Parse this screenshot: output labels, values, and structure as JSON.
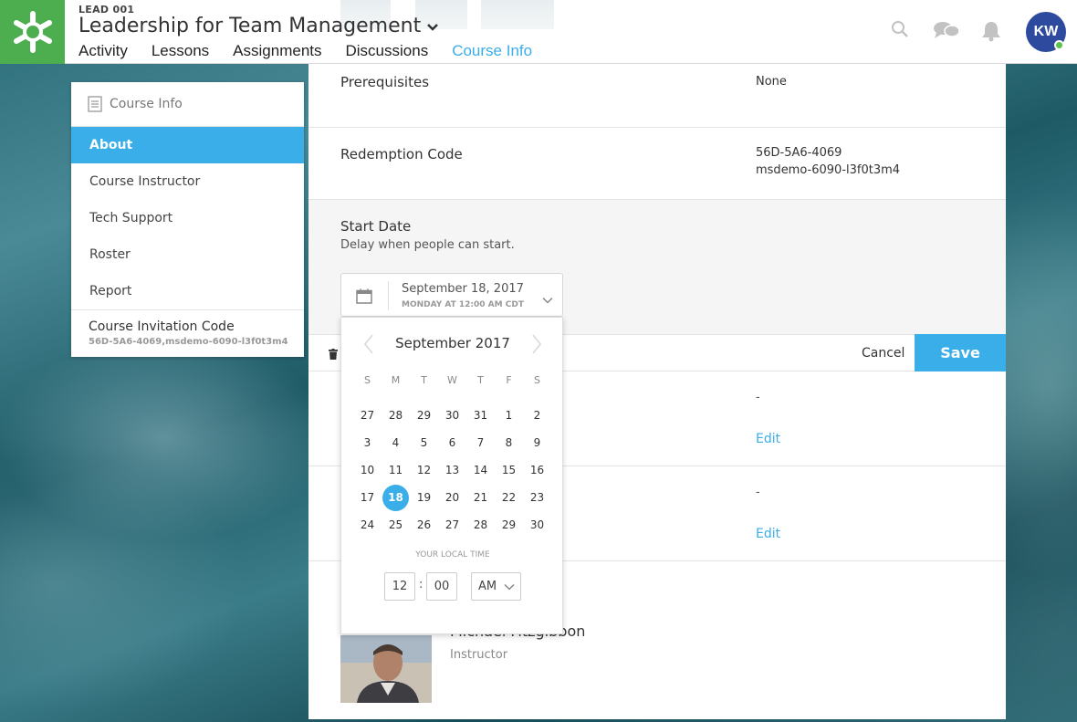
{
  "header": {
    "course_code": "LEAD 001",
    "course_title": "Leadership for Team Management",
    "tabs": [
      {
        "label": "Activity"
      },
      {
        "label": "Lessons"
      },
      {
        "label": "Assignments"
      },
      {
        "label": "Discussions"
      },
      {
        "label": "Course Info",
        "active": true
      }
    ],
    "avatar_initials": "KW",
    "icons": [
      "search-icon",
      "chat-icon",
      "bell-icon"
    ],
    "brand_color": "#4cae4f",
    "accent_color": "#3aaee8"
  },
  "sidebar": {
    "title": "Course Info",
    "items": [
      {
        "label": "About",
        "active": true
      },
      {
        "label": "Course Instructor"
      },
      {
        "label": "Tech Support"
      },
      {
        "label": "Roster"
      },
      {
        "label": "Report"
      }
    ],
    "invitation_label": "Course Invitation Code",
    "invitation_code": "56D-5A6-4069,msdemo-6090-l3f0t3m4"
  },
  "main": {
    "prerequisites_label": "Prerequisites",
    "prerequisites_value": "None",
    "redemption_label": "Redemption Code",
    "redemption_line1": "56D-5A6-4069",
    "redemption_line2": "msdemo-6090-l3f0t3m4",
    "start_date_label": "Start Date",
    "start_date_sub": "Delay when people can start.",
    "start_date_value": "September 18, 2017",
    "start_date_time": "MONDAY AT 12:00 AM CDT",
    "cancel_label": "Cancel",
    "save_label": "Save",
    "row1_value": "-",
    "row1_edit": "Edit",
    "row2_value": "-",
    "row2_edit": "Edit",
    "instructor_name": "Michael Fitzgibbon",
    "instructor_role": "Instructor"
  },
  "datepicker": {
    "month_label": "September 2017",
    "weekdays": [
      "S",
      "M",
      "T",
      "W",
      "T",
      "F",
      "S"
    ],
    "weeks": [
      [
        "27",
        "28",
        "29",
        "30",
        "31",
        "1",
        "2"
      ],
      [
        "3",
        "4",
        "5",
        "6",
        "7",
        "8",
        "9"
      ],
      [
        "10",
        "11",
        "12",
        "13",
        "14",
        "15",
        "16"
      ],
      [
        "17",
        "18",
        "19",
        "20",
        "21",
        "22",
        "23"
      ],
      [
        "24",
        "25",
        "26",
        "27",
        "28",
        "29",
        "30"
      ]
    ],
    "selected_day": "18",
    "local_time_label": "YOUR LOCAL TIME",
    "hour": "12",
    "minute": "00",
    "ampm": "AM"
  }
}
